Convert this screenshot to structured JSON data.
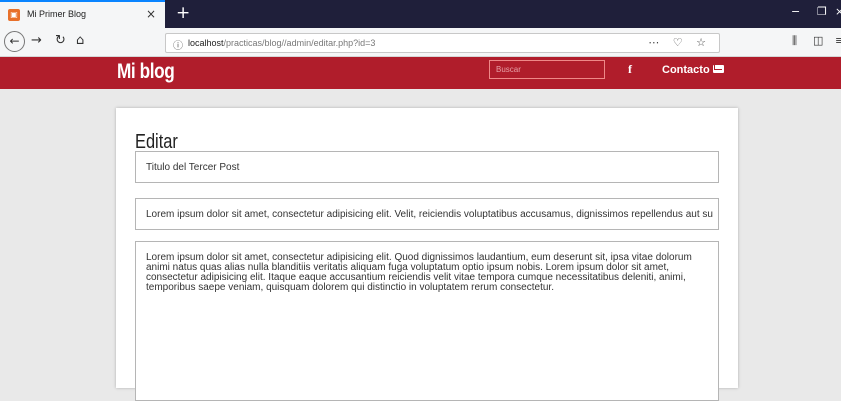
{
  "browser": {
    "tab_title": "Mi Primer Blog",
    "favicon": "blog-favicon",
    "new_tab": "+",
    "close_tab": "×",
    "url_host": "localhost",
    "url_path": "/practicas/blog//admin/editar.php?id=3",
    "win_min": "−",
    "win_max": "❐",
    "win_close": "×"
  },
  "site": {
    "brand": "Mi blog",
    "search_placeholder": "Buscar",
    "facebook_glyph": "f",
    "contact_label": "Contacto",
    "accent_color": "#b01d2b"
  },
  "editor": {
    "heading": "Editar",
    "title_value": "Titulo del Tercer Post",
    "summary_value": "Lorem ipsum dolor sit amet, consectetur adipisicing elit. Velit, reiciendis voluptatibus accusamus, dignissimos repellendus aut su",
    "body_value": "Lorem ipsum dolor sit amet, consectetur adipisicing elit. Quod dignissimos laudantium, eum deserunt sit, ipsa vitae dolorum animi natus quas alias nulla blanditiis veritatis aliquam fuga voluptatum optio ipsum nobis. Lorem ipsum dolor sit amet, consectetur adipisicing elit. Itaque eaque accusantium reiciendis velit vitae tempora cumque necessitatibus deleniti, animi, temporibus saepe veniam, quisquam dolorem qui distinctio in voluptatem rerum consectetur."
  }
}
